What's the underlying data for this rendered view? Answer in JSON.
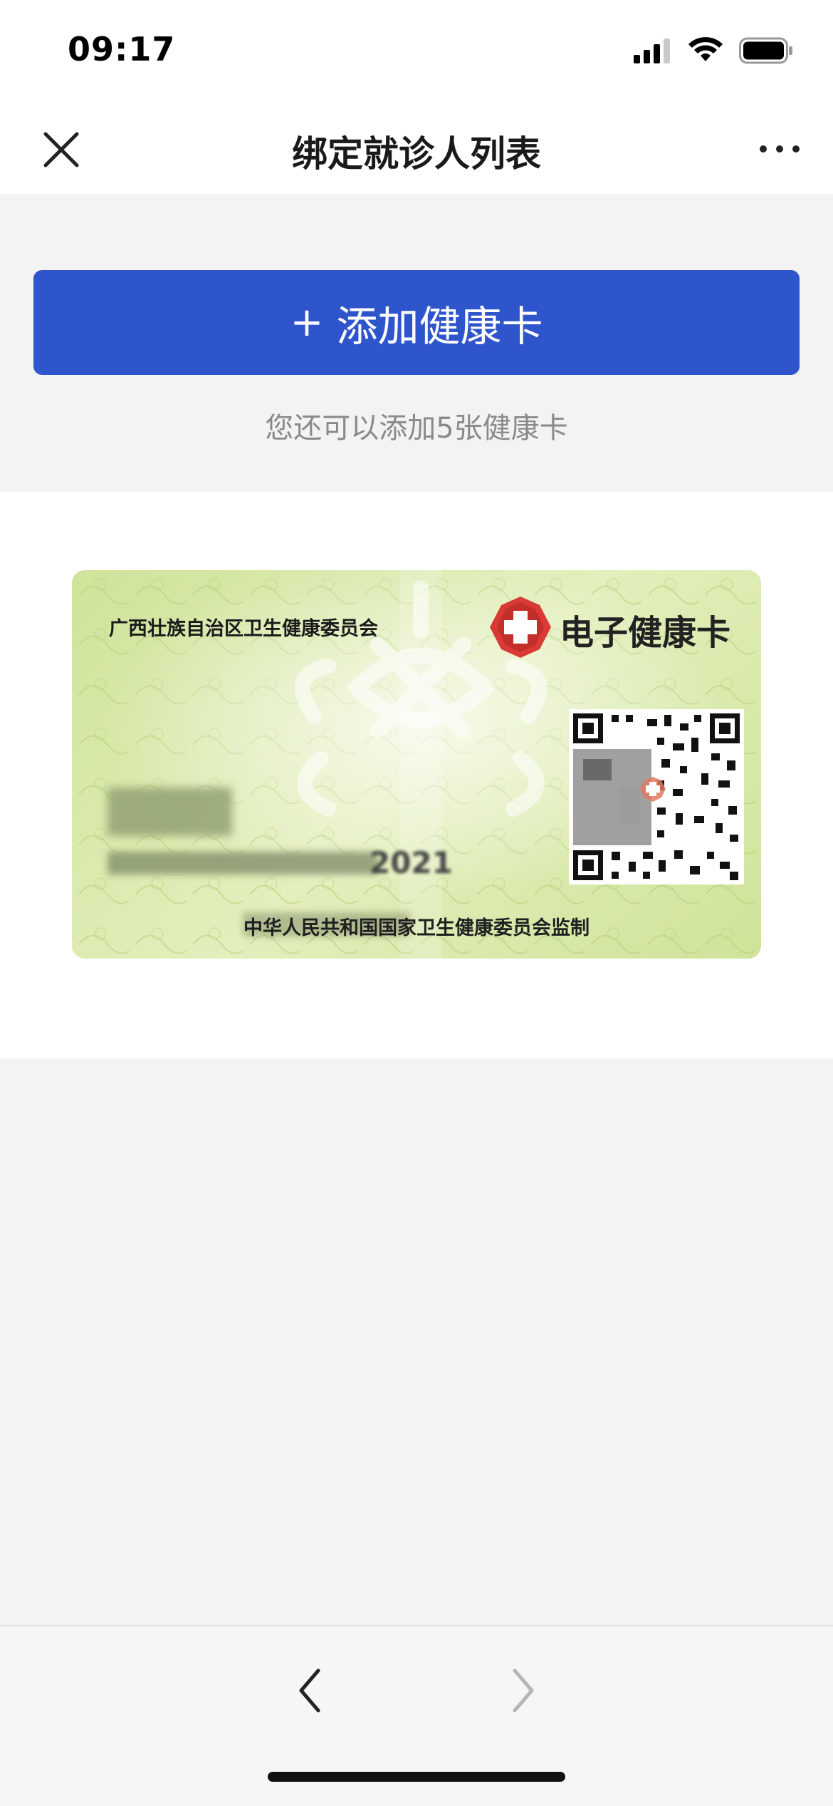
{
  "status_bar": {
    "time": "09:17"
  },
  "nav": {
    "title": "绑定就诊人列表"
  },
  "add_card": {
    "button_plus": "+",
    "button_label": "添加健康卡",
    "hint": "您还可以添加5张健康卡"
  },
  "health_card": {
    "issuer": "广西壮族自治区卫生健康委员会",
    "brand": "电子健康卡",
    "number_suffix": "2021",
    "footer": "中华人民共和国国家卫生健康委员会监制"
  },
  "colors": {
    "accent": "#2f55cc",
    "card_green": "#d6e8a6",
    "logo_red": "#d93a35"
  },
  "icons": {
    "close": "close-icon",
    "more": "more-icon",
    "back": "chevron-left-icon",
    "forward": "chevron-right-icon",
    "signal": "cellular-signal-icon",
    "wifi": "wifi-icon",
    "battery": "battery-icon"
  }
}
